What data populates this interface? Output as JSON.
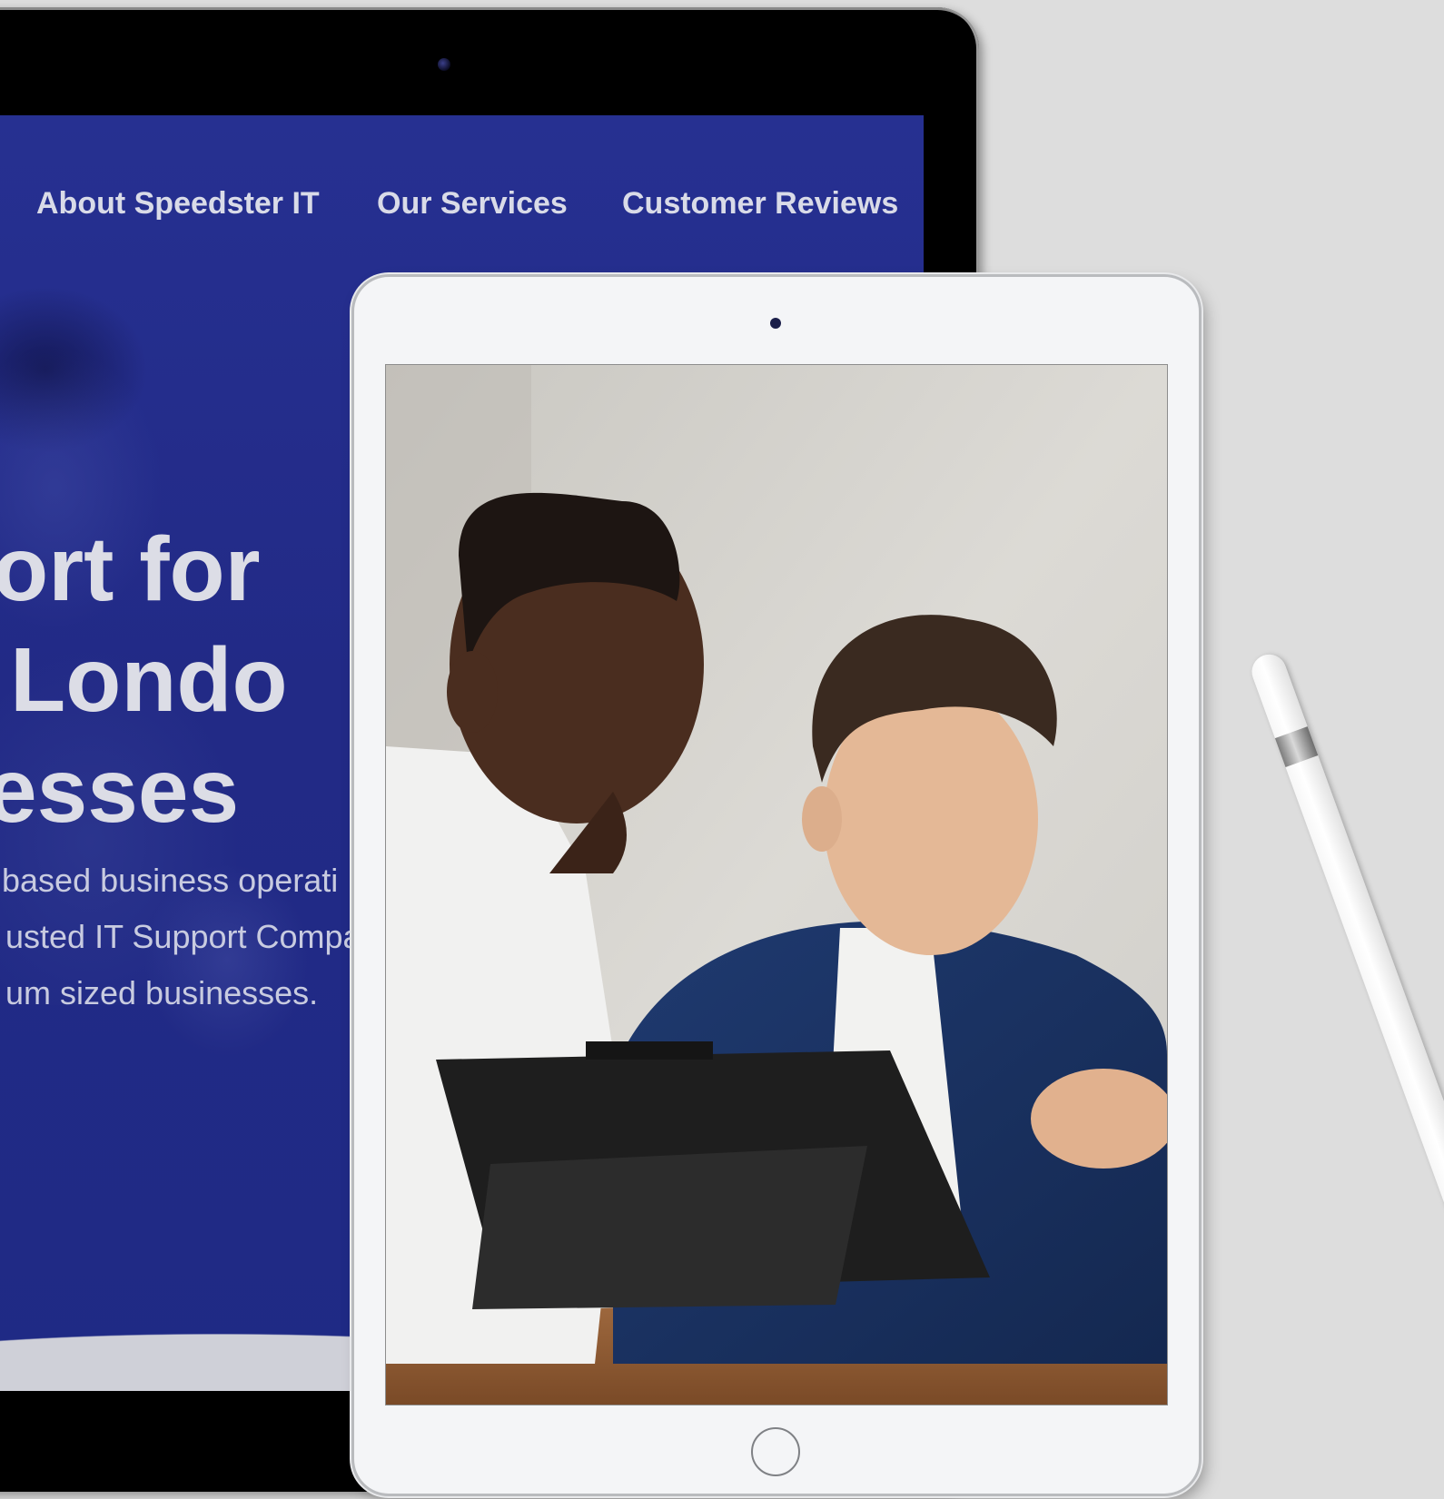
{
  "back_tablet": {
    "nav": {
      "items": [
        {
          "label": "About Speedster IT"
        },
        {
          "label": "Our Services"
        },
        {
          "label": "Customer Reviews"
        }
      ]
    },
    "hero": {
      "lines": [
        "pport for",
        "al Londo",
        "esses"
      ]
    },
    "body": {
      "lines": [
        "based business operati",
        "usted IT Support Compa",
        "um sized businesses."
      ]
    },
    "colors": {
      "screen_bg": "#222a86",
      "nav_text": "#d9dbe8",
      "hero_text": "#dcdde6"
    }
  },
  "front_tablet": {
    "photo": "two-men-looking-at-tablet",
    "colors": {
      "bezel": "#f4f5f7"
    }
  },
  "accessory": {
    "icon": "stylus-pencil"
  }
}
